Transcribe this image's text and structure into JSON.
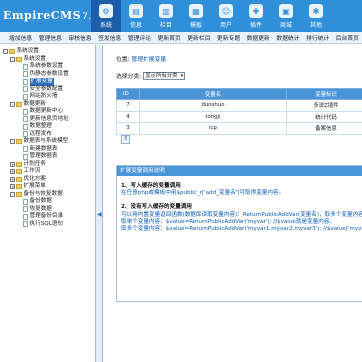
{
  "app": {
    "logo_main": "EmpireCMS",
    "logo_version": "7.0"
  },
  "nav": [
    {
      "label": "系统",
      "icon": "gear-icon",
      "active": true
    },
    {
      "label": "信息",
      "icon": "document-icon"
    },
    {
      "label": "栏目",
      "icon": "folder-icon"
    },
    {
      "label": "模板",
      "icon": "template-icon"
    },
    {
      "label": "用户",
      "icon": "user-icon"
    },
    {
      "label": "插件",
      "icon": "plugin-icon"
    },
    {
      "label": "商城",
      "icon": "cart-icon"
    },
    {
      "label": "其他",
      "icon": "more-icon"
    }
  ],
  "subnav": [
    "增加信息",
    "管理信息",
    "审核信息",
    "签发信息",
    "管理评论",
    "更新首页",
    "更新栏目",
    "更新专题",
    "数据更新",
    "数据统计",
    "排行统计",
    "后台首页"
  ],
  "sidebar": {
    "items": [
      {
        "label": "系统设置",
        "level": 0,
        "exp": "-",
        "type": "root"
      },
      {
        "label": "系统设置",
        "level": 1,
        "exp": "-",
        "type": "folder"
      },
      {
        "label": "系统参数设置",
        "level": 2,
        "type": "doc"
      },
      {
        "label": "伪静态参数设置",
        "level": 2,
        "type": "doc"
      },
      {
        "label": "扩展变量",
        "level": 2,
        "type": "doc",
        "highlight": true
      },
      {
        "label": "安全参数配置",
        "level": 2,
        "type": "doc"
      },
      {
        "label": "网站防火墙",
        "level": 2,
        "type": "doc"
      },
      {
        "label": "数据更新",
        "level": 1,
        "exp": "-",
        "type": "folder"
      },
      {
        "label": "数据更新中心",
        "level": 2,
        "type": "doc"
      },
      {
        "label": "更新信息页地址",
        "level": 2,
        "type": "doc"
      },
      {
        "label": "数据整理",
        "level": 2,
        "type": "doc"
      },
      {
        "label": "远程发布",
        "level": 2,
        "type": "doc"
      },
      {
        "label": "数据表与系统模型",
        "level": 1,
        "exp": "-",
        "type": "folder"
      },
      {
        "label": "新建数据表",
        "level": 2,
        "type": "doc"
      },
      {
        "label": "管理数据表",
        "level": 2,
        "type": "doc"
      },
      {
        "label": "计划任务",
        "level": 1,
        "exp": "+",
        "type": "folder"
      },
      {
        "label": "工作流",
        "level": 1,
        "exp": "+",
        "type": "folder"
      },
      {
        "label": "优化方案",
        "level": 1,
        "exp": "+",
        "type": "folder"
      },
      {
        "label": "扩展菜单",
        "level": 1,
        "exp": "+",
        "type": "folder"
      },
      {
        "label": "备份与恢复数据",
        "level": 1,
        "exp": "-",
        "type": "folder"
      },
      {
        "label": "备份数据",
        "level": 2,
        "type": "doc"
      },
      {
        "label": "恢复数据",
        "level": 2,
        "type": "doc"
      },
      {
        "label": "管理备份目录",
        "level": 2,
        "type": "doc"
      },
      {
        "label": "执行SQL语句",
        "level": 2,
        "type": "doc"
      }
    ]
  },
  "main": {
    "location_prefix": "位置:",
    "location_link": "管理扩展变量",
    "filter_label": "选择分类:",
    "filter_value": "显示所有分类",
    "table": {
      "headers": [
        "ID",
        "变量名",
        "变量标识"
      ],
      "rows": [
        {
          "id": "7",
          "name": "duoshuo",
          "label": "多说Z插件"
        },
        {
          "id": "4",
          "name": "tongji",
          "label": "统计代码"
        },
        {
          "id": "3",
          "name": "icp",
          "label": "备案信息"
        }
      ]
    },
    "pager": "3",
    "help": {
      "title": "扩展变量调用说明",
      "h1": "1、写入缓存的变量调用",
      "p1": "在任意php或模板中用$public_r['add_变量名']可取得变量内容。",
      "h2": "2、没有写入缓存的变量调用",
      "p2": "可以用内置变量返回函数(数据库读取变量内容)：ReturnPublicAddVar(变量名)，取多个变量内容可以",
      "p3": "取单个变量内容：$value=ReturnPublicAddVar('myvar'); //$value就是变量内容。",
      "p4": "取多个变量内容：$value=ReturnPublicAddVar('myvar1,myvar2,myvar3'); //$value['myvar1']才"
    }
  },
  "colors": {
    "header_bg": "#2f8fd8",
    "nav_active": "#1b5fa8",
    "table_header": "#4a95d8",
    "link": "#0b5bb8"
  }
}
